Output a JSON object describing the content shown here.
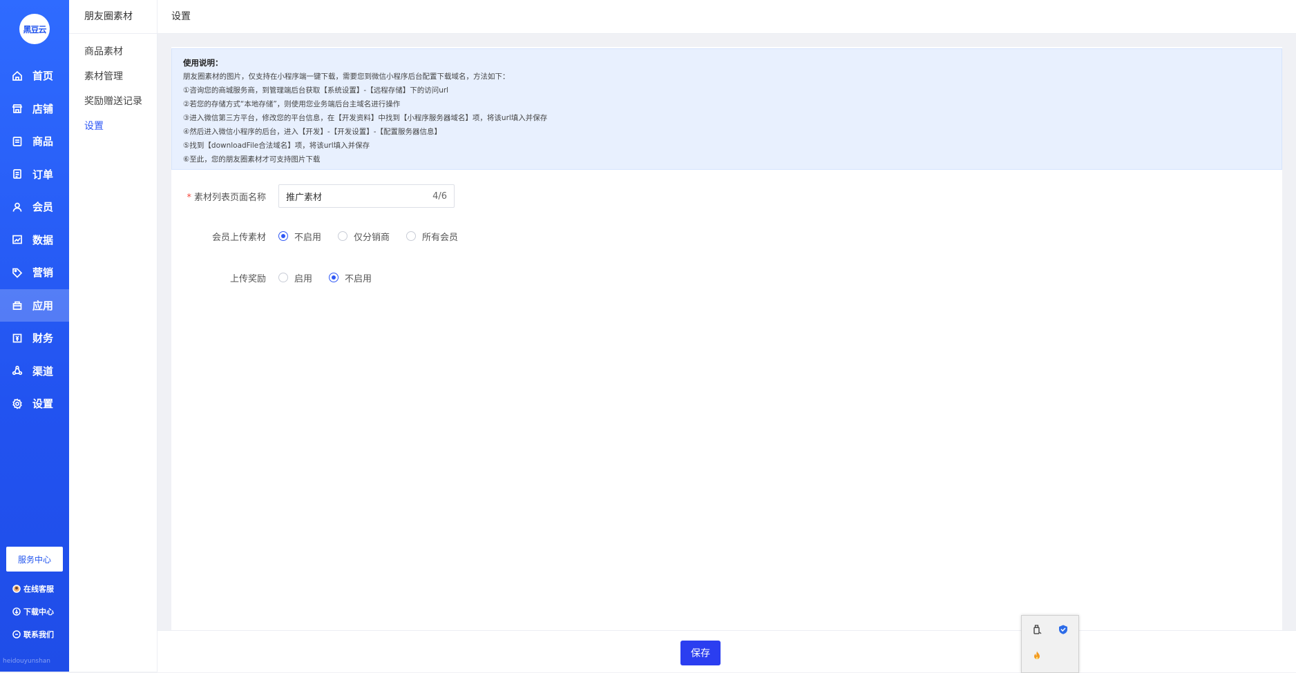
{
  "sidebar": {
    "logo_text": "黑豆云",
    "items": [
      {
        "label": "首页",
        "icon": "home-icon"
      },
      {
        "label": "店铺",
        "icon": "store-icon"
      },
      {
        "label": "商品",
        "icon": "goods-icon"
      },
      {
        "label": "订单",
        "icon": "order-icon"
      },
      {
        "label": "会员",
        "icon": "user-icon"
      },
      {
        "label": "数据",
        "icon": "chart-icon"
      },
      {
        "label": "营销",
        "icon": "tag-icon"
      },
      {
        "label": "应用",
        "icon": "app-icon"
      },
      {
        "label": "财务",
        "icon": "finance-icon"
      },
      {
        "label": "渠道",
        "icon": "channel-icon"
      },
      {
        "label": "设置",
        "icon": "settings-icon"
      }
    ],
    "active_index": 7,
    "service_center": "服务中心",
    "links": [
      {
        "label": "在线客服",
        "icon": "avatar-icon"
      },
      {
        "label": "下载中心",
        "icon": "download-icon"
      },
      {
        "label": "联系我们",
        "icon": "chat-icon"
      }
    ],
    "brand_footer": "heidouyunshan"
  },
  "subnav": {
    "title": "朋友圈素材",
    "items": [
      "商品素材",
      "素材管理",
      "奖励赠送记录",
      "设置"
    ],
    "active_index": 3
  },
  "breadcrumb": "设置",
  "notice": {
    "title": "使用说明：",
    "lines": [
      "朋友圈素材的图片，仅支持在小程序端一键下载，需要您到微信小程序后台配置下载域名，方法如下：",
      "①咨询您的商城服务商，到管理端后台获取【系统设置】-【远程存储】下的访问url",
      "②若您的存储方式“本地存储”，则使用您业务端后台主域名进行操作",
      "③进入微信第三方平台，修改您的平台信息，在【开发资料】中找到【小程序服务器域名】项，将该url填入并保存",
      "④然后进入微信小程序的后台，进入【开发】-【开发设置】-【配置服务器信息】",
      "⑤找到【downloadFile合法域名】项，将该url填入并保存",
      "⑥至此，您的朋友圈素材才可支持图片下载"
    ]
  },
  "form": {
    "page_name": {
      "required_mark": "*",
      "label": "素材列表页面名称",
      "value": "推广素材",
      "count": "4/6"
    },
    "member_upload": {
      "label": "会员上传素材",
      "options": [
        "不启用",
        "仅分销商",
        "所有会员"
      ],
      "selected": 0
    },
    "upload_reward": {
      "label": "上传奖励",
      "options": [
        "启用",
        "不启用"
      ],
      "selected": 1
    }
  },
  "footer": {
    "save_label": "保存"
  }
}
